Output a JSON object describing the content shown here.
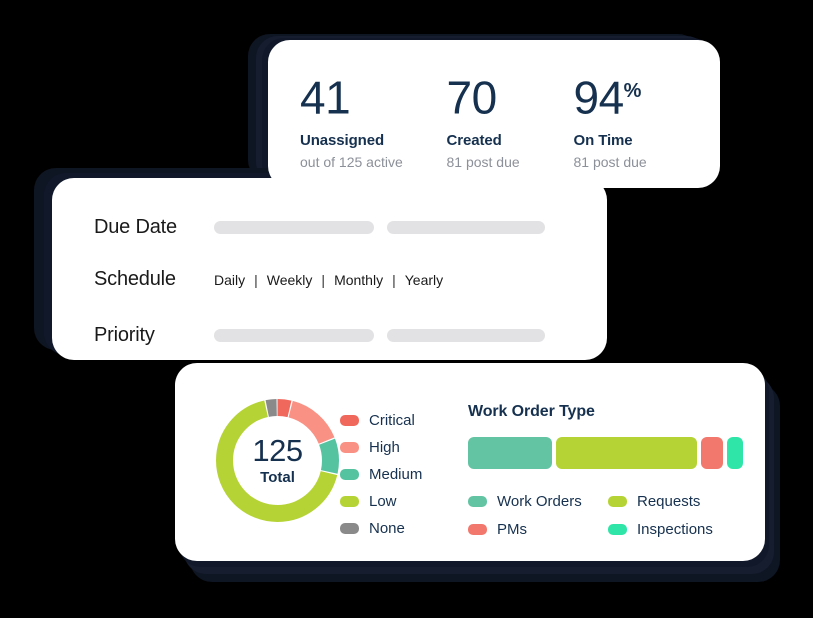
{
  "stats_card": {
    "items": [
      {
        "value": "41",
        "suffix": "",
        "label": "Unassigned",
        "sub": "out of 125 active"
      },
      {
        "value": "70",
        "suffix": "",
        "label": "Created",
        "sub": "81 post due"
      },
      {
        "value": "94",
        "suffix": "%",
        "label": "On Time",
        "sub": "81 post due"
      }
    ]
  },
  "filters_card": {
    "rows": [
      {
        "label": "Due Date",
        "type": "pills"
      },
      {
        "label": "Schedule",
        "type": "options",
        "options": [
          "Daily",
          "Weekly",
          "Monthly",
          "Yearly"
        ],
        "separator": "|"
      },
      {
        "label": "Priority",
        "type": "pills"
      }
    ]
  },
  "charts_card": {
    "donut": {
      "center_value": "125",
      "center_label": "Total",
      "legend": [
        {
          "label": "Critical",
          "color": "#f0675c"
        },
        {
          "label": "High",
          "color": "#f99184"
        },
        {
          "label": "Medium",
          "color": "#56c3a0"
        },
        {
          "label": "Low",
          "color": "#b5d335"
        },
        {
          "label": "None",
          "color": "#8a8a8a"
        }
      ]
    },
    "work_order_type": {
      "title": "Work Order Type",
      "legend": [
        {
          "label": "Work Orders",
          "color": "#63c4a4"
        },
        {
          "label": "Requests",
          "color": "#b5d335"
        },
        {
          "label": "PMs",
          "color": "#f2776c"
        },
        {
          "label": "Inspections",
          "color": "#2fe6a8"
        }
      ]
    }
  },
  "chart_data": [
    {
      "type": "pie",
      "title": "Priority breakdown",
      "center_label": "125 Total",
      "total": 125,
      "categories": [
        "Critical",
        "High",
        "Medium",
        "Low",
        "None"
      ],
      "values": [
        5,
        19,
        12,
        85,
        4
      ],
      "colors": [
        "#f0675c",
        "#f99184",
        "#56c3a0",
        "#b5d335",
        "#8a8a8a"
      ],
      "legend_position": "right",
      "donut": true
    },
    {
      "type": "bar",
      "title": "Work Order Type",
      "orientation": "horizontal-stacked",
      "categories": [
        "Work Orders",
        "Requests",
        "PMs",
        "Inspections"
      ],
      "values": [
        85,
        143,
        23,
        16
      ],
      "unit": "px-width",
      "colors": [
        "#63c4a4",
        "#b5d335",
        "#f2776c",
        "#2fe6a8"
      ],
      "legend_position": "bottom",
      "grid": false
    }
  ]
}
